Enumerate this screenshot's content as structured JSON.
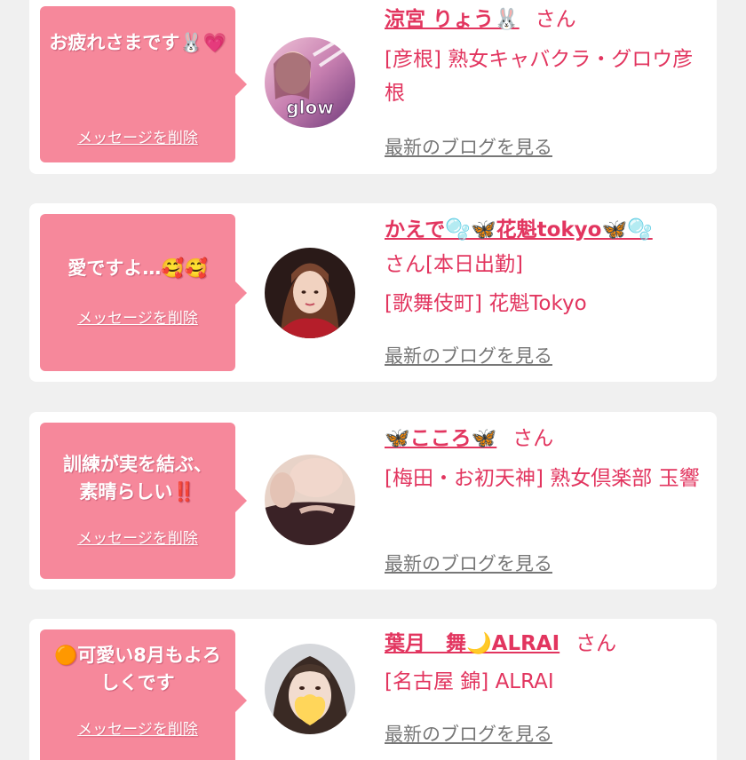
{
  "cards": [
    {
      "message": "お疲れさまです🐰💗",
      "delete_label": "メッセージを削除",
      "name": "涼宮 りょう🐰",
      "san": "さん",
      "shop": "[彦根] 熟女キャバクラ・グロウ彦根",
      "blog_label": "最新のブログを見る",
      "avatar_text": "glow"
    },
    {
      "message": "愛ですよ…🥰🥰",
      "delete_label": "メッセージを削除",
      "name": "かえで🫧🦋花魁tokyo🦋🫧",
      "san": "さん[本日出勤]",
      "shop": "[歌舞伎町] 花魁Tokyo",
      "blog_label": "最新のブログを見る"
    },
    {
      "message": "訓練が実を結ぶ、素晴らしい‼️",
      "delete_label": "メッセージを削除",
      "name": "🦋こころ🦋",
      "san": "さん",
      "shop": "[梅田・お初天神] 熟女倶楽部 玉響",
      "blog_label": "最新のブログを見る"
    },
    {
      "message": "🟠可愛い8月もよろしくです",
      "delete_label": "メッセージを削除",
      "name": "葉月　舞🌙ALRAI",
      "san": "さん",
      "shop": "[名古屋 錦] ALRAI",
      "blog_label": "最新のブログを見る"
    }
  ],
  "colors": {
    "accent": "#e2355f",
    "bubble": "#f6889b",
    "background": "#f0f0f0",
    "link_gray": "#777777"
  }
}
